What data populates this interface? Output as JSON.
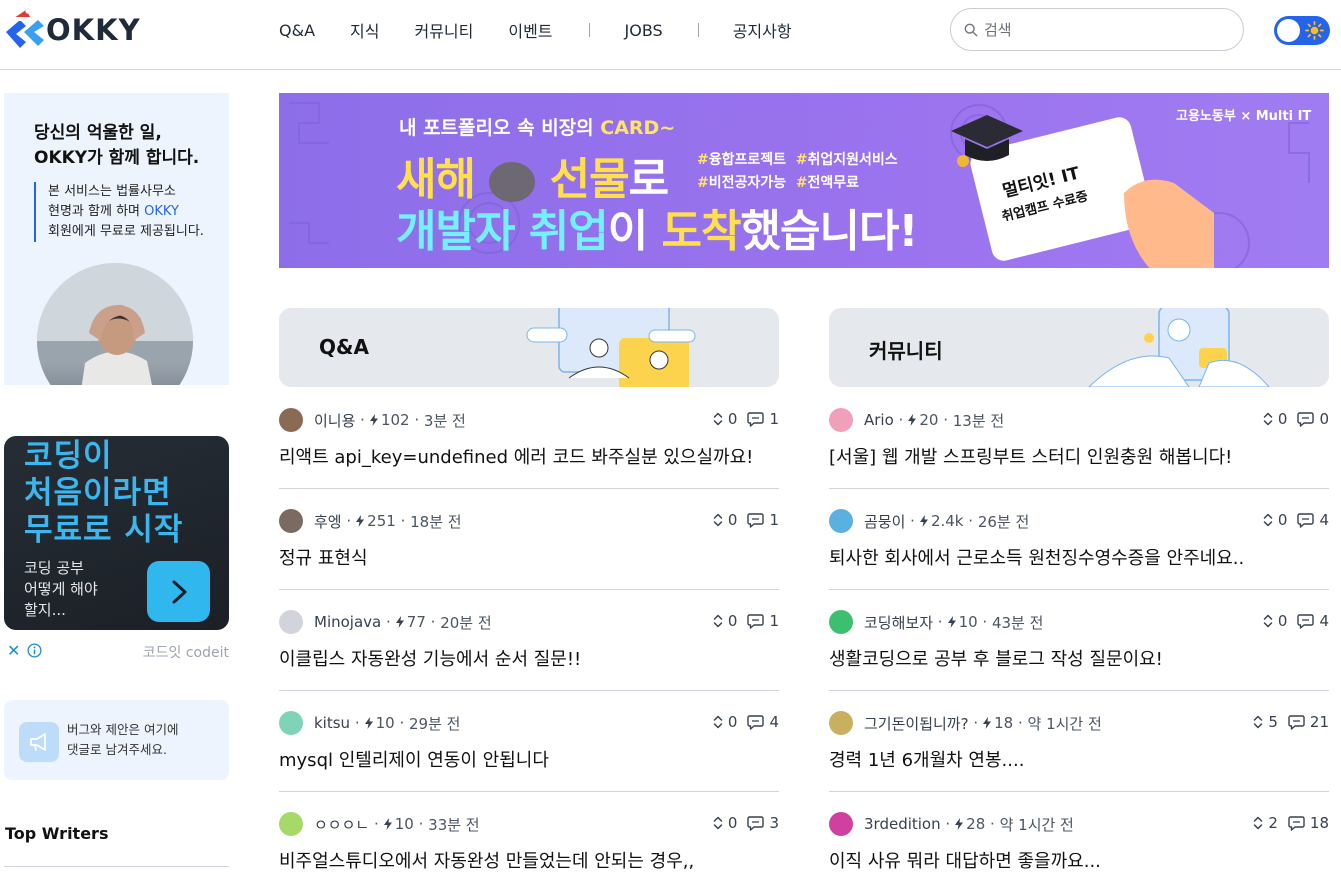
{
  "header": {
    "logo_text": "OKKY",
    "nav": [
      "Q&A",
      "지식",
      "커뮤니티",
      "이벤트",
      "JOBS",
      "공지사항"
    ],
    "search_placeholder": "검색"
  },
  "sidebar": {
    "ad1": {
      "title_line1": "당신의 억울한 일,",
      "title_line2": "OKKY가 함께 합니다.",
      "desc_line1": "본 서비스는 법률사무소",
      "desc_line2_pre": "현명과 함께 하며 ",
      "desc_line2_hl": "OKKY",
      "desc_line3": "회원에게 무료로 제공됩니다."
    },
    "ad2": {
      "head_line1": "코딩이",
      "head_line2": "처음이라면",
      "head_line3": "무료로 시작",
      "sub_line1": "코딩 공부",
      "sub_line2": "어떻게 해야",
      "sub_line3": "할지...",
      "close_glyph": "✕",
      "brand": "코드잇 codeit"
    },
    "feedback": {
      "line1": "버그와 제안은 여기에",
      "line2": "댓글로 남겨주세요."
    },
    "top_writers": "Top Writers"
  },
  "banner": {
    "top_pre": "내 포트폴리오 속 비장의 ",
    "top_hl": "CARD~",
    "big1_a": "새해",
    "big1_b": "선물",
    "big1_c": "로",
    "big2_a": "개발자 취업",
    "big2_b": "이 ",
    "big2_c": "도착",
    "big2_d": "했습니다!",
    "tag1": "융합프로젝트",
    "tag2": "취업지원서비스",
    "tag3": "비전공자가능",
    "tag4": "전액무료",
    "logo": "고용노동부 × Multi IT",
    "card_t1": "멀티잇! IT",
    "card_t2": "취업캠프 수료증"
  },
  "sections": {
    "qna_title": "Q&A",
    "community_title": "커뮤니티"
  },
  "qna_posts": [
    {
      "author": "이니용",
      "points": "102",
      "time": "3분 전",
      "votes": "0",
      "comments": "1",
      "title": "리액트 api_key=undefined 에러 코드 봐주실분 있으실까요!",
      "avatar": "#8a6a55"
    },
    {
      "author": "후엥",
      "points": "251",
      "time": "18분 전",
      "votes": "0",
      "comments": "1",
      "title": "정규 표현식",
      "avatar": "#7a6a60"
    },
    {
      "author": "Minojava",
      "points": "77",
      "time": "20분 전",
      "votes": "0",
      "comments": "1",
      "title": "이클립스 자동완성 기능에서 순서 질문!!",
      "avatar": "#d1d5db"
    },
    {
      "author": "kitsu",
      "points": "10",
      "time": "29분 전",
      "votes": "0",
      "comments": "4",
      "title": "mysql 인텔리제이 연동이 안됩니다",
      "avatar": "#7fd4b8"
    },
    {
      "author": "ㅇㅇㅇㄴ",
      "points": "10",
      "time": "33분 전",
      "votes": "0",
      "comments": "3",
      "title": "비주얼스튜디오에서 자동완성 만들었는데 안되는 경우,,",
      "avatar": "#a6d86a"
    }
  ],
  "community_posts": [
    {
      "author": "Ario",
      "points": "20",
      "time": "13분 전",
      "votes": "0",
      "comments": "0",
      "title": "[서울] 웹 개발 스프링부트 스터디 인원충원 해봅니다!",
      "avatar": "#f0a0b8"
    },
    {
      "author": "곰뭉이",
      "points": "2.4k",
      "time": "26분 전",
      "votes": "0",
      "comments": "4",
      "title": "퇴사한 회사에서 근로소득 원천징수영수증을 안주네요..",
      "avatar": "#5bb0e0"
    },
    {
      "author": "코딩해보자",
      "points": "10",
      "time": "43분 전",
      "votes": "0",
      "comments": "4",
      "title": "생활코딩으로 공부 후 블로그 작성 질문이요!",
      "avatar": "#3cc070"
    },
    {
      "author": "그기돈이됩니까?",
      "points": "18",
      "time": "약 1시간 전",
      "votes": "5",
      "comments": "21",
      "title": "경력 1년 6개월차 연봉....",
      "avatar": "#c8b060"
    },
    {
      "author": "3rdedition",
      "points": "28",
      "time": "약 1시간 전",
      "votes": "2",
      "comments": "18",
      "title": "이직 사유 뭐라 대답하면 좋을까요...",
      "avatar": "#d040a0"
    }
  ],
  "colors": {
    "accent": "#2563eb",
    "codeit": "#2fb7ee",
    "banner": "#9b73ee"
  }
}
